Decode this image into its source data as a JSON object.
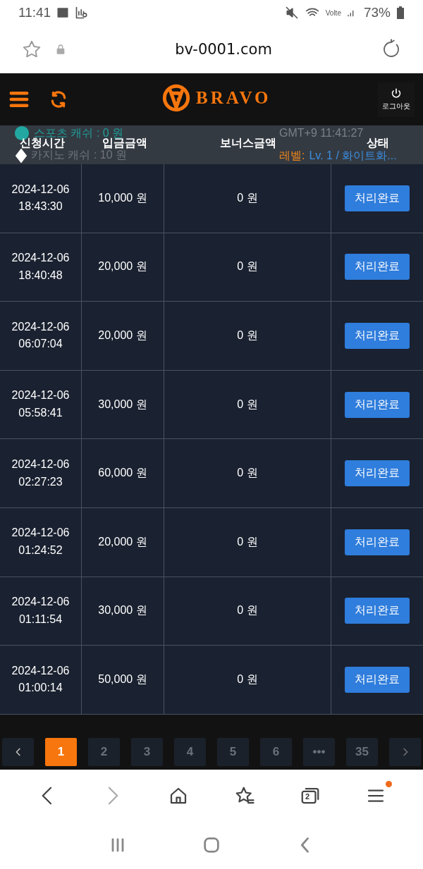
{
  "status_bar": {
    "time": "11:41",
    "network": "Volte",
    "battery": "73%"
  },
  "browser_bar": {
    "url": "bv-0001.com"
  },
  "header": {
    "logo": "BRAVO",
    "logout": "로그아웃"
  },
  "info": {
    "sports_cash": "스포츠 캐쉬 :   0 원",
    "casino_cash": "카지노 캐쉬 :   10 원",
    "clock": "GMT+9 11:41:27",
    "level_label": "레벨:",
    "level_value": "Lv. 1 / 화이트화..."
  },
  "table": {
    "columns": [
      "신청시간",
      "입금금액",
      "보너스금액",
      "상태"
    ],
    "rows": [
      {
        "date": "2024-12-06",
        "time": "18:43:30",
        "amount": "10,000 원",
        "bonus": "0 원",
        "status": "처리완료"
      },
      {
        "date": "2024-12-06",
        "time": "18:40:48",
        "amount": "20,000 원",
        "bonus": "0 원",
        "status": "처리완료"
      },
      {
        "date": "2024-12-06",
        "time": "06:07:04",
        "amount": "20,000 원",
        "bonus": "0 원",
        "status": "처리완료"
      },
      {
        "date": "2024-12-06",
        "time": "05:58:41",
        "amount": "30,000 원",
        "bonus": "0 원",
        "status": "처리완료"
      },
      {
        "date": "2024-12-06",
        "time": "02:27:23",
        "amount": "60,000 원",
        "bonus": "0 원",
        "status": "처리완료"
      },
      {
        "date": "2024-12-06",
        "time": "01:24:52",
        "amount": "20,000 원",
        "bonus": "0 원",
        "status": "처리완료"
      },
      {
        "date": "2024-12-06",
        "time": "01:11:54",
        "amount": "30,000 원",
        "bonus": "0 원",
        "status": "처리완료"
      },
      {
        "date": "2024-12-06",
        "time": "01:00:14",
        "amount": "50,000 원",
        "bonus": "0 원",
        "status": "처리완료"
      }
    ]
  },
  "pagination": [
    {
      "kind": "prev",
      "selected": false
    },
    {
      "kind": "page",
      "label": "1",
      "selected": true
    },
    {
      "kind": "page",
      "label": "2",
      "selected": false
    },
    {
      "kind": "page",
      "label": "3",
      "selected": false
    },
    {
      "kind": "page",
      "label": "4",
      "selected": false
    },
    {
      "kind": "page",
      "label": "5",
      "selected": false
    },
    {
      "kind": "page",
      "label": "6",
      "selected": false
    },
    {
      "kind": "page",
      "label": "•••",
      "selected": false
    },
    {
      "kind": "page",
      "label": "35",
      "selected": false
    },
    {
      "kind": "next",
      "selected": false
    }
  ],
  "bottom_nav": {
    "tab_count": "2",
    "menu_badge": true
  }
}
